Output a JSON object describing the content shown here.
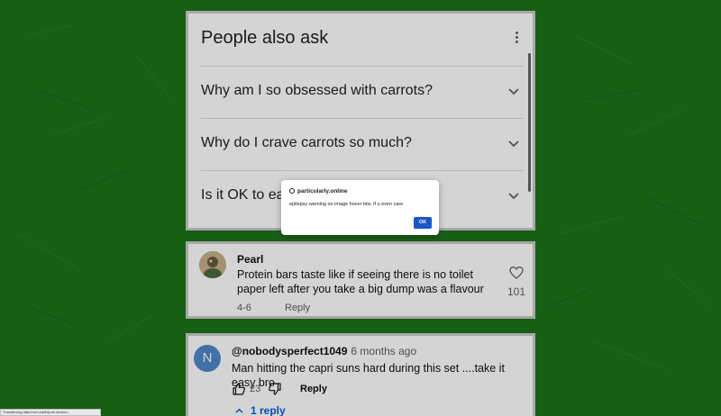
{
  "colors": {
    "background": "#1c7319",
    "link_blue": "#065fd4",
    "dialog_button": "#1a56c9"
  },
  "people_also_ask": {
    "title": "People also ask",
    "menu_icon": "more-vert-icon",
    "questions": [
      "Why am I so obsessed with carrots?",
      "Why do I crave carrots so much?",
      "Is it OK to ea"
    ]
  },
  "comments": [
    {
      "author": "Pearl",
      "text": "Protein bars taste like if seeing there is no toilet paper left after you take a big dump was a flavour",
      "date": "4-6",
      "reply_label": "Reply",
      "like_count": "101",
      "like_icon": "heart-icon"
    },
    {
      "avatar_letter": "N",
      "author": "@nobodysperfect1049",
      "time": "6 months ago",
      "text": "Man hitting the capri suns hard during this set ....take it easy bro",
      "likes": "23",
      "reply_label": "Reply",
      "replies_label": "1 reply"
    }
  ],
  "dialog": {
    "origin": "particularly.online",
    "message": "epilepsy warning on image hover btw. if u even care",
    "ok_label": "OK"
  },
  "status_bar": {
    "text": "Transferring data from earthlyorb.serios.l..."
  }
}
